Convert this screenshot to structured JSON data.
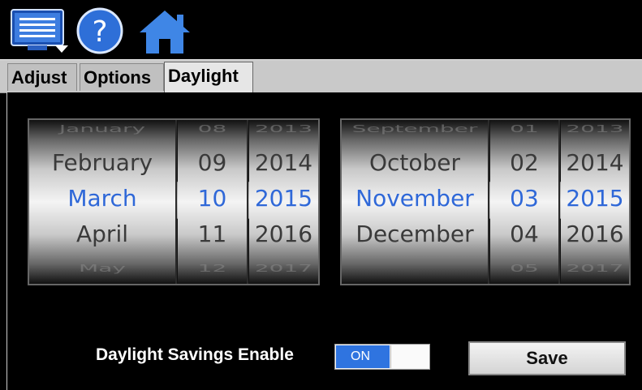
{
  "tabs": [
    "Adjust",
    "Options",
    "Daylight"
  ],
  "active_tab": "Daylight",
  "start_picker": {
    "month": {
      "above": "January",
      "prev": "February",
      "selected": "March",
      "next": "April",
      "below": "May"
    },
    "day": {
      "above": "08",
      "prev": "09",
      "selected": "10",
      "next": "11",
      "below": "12"
    },
    "year": {
      "above": "2013",
      "prev": "2014",
      "selected": "2015",
      "next": "2016",
      "below": "2017"
    }
  },
  "end_picker": {
    "month": {
      "above": "September",
      "prev": "October",
      "selected": "November",
      "next": "December",
      "below": ""
    },
    "day": {
      "above": "01",
      "prev": "02",
      "selected": "03",
      "next": "04",
      "below": "05"
    },
    "year": {
      "above": "2013",
      "prev": "2014",
      "selected": "2015",
      "next": "2016",
      "below": "2017"
    }
  },
  "daylight_label": "Daylight Savings Enable",
  "toggle": {
    "state": "ON"
  },
  "save_label": "Save",
  "colors": {
    "selected_text": "#2f68d8",
    "toggle_on": "#2f74e0"
  }
}
